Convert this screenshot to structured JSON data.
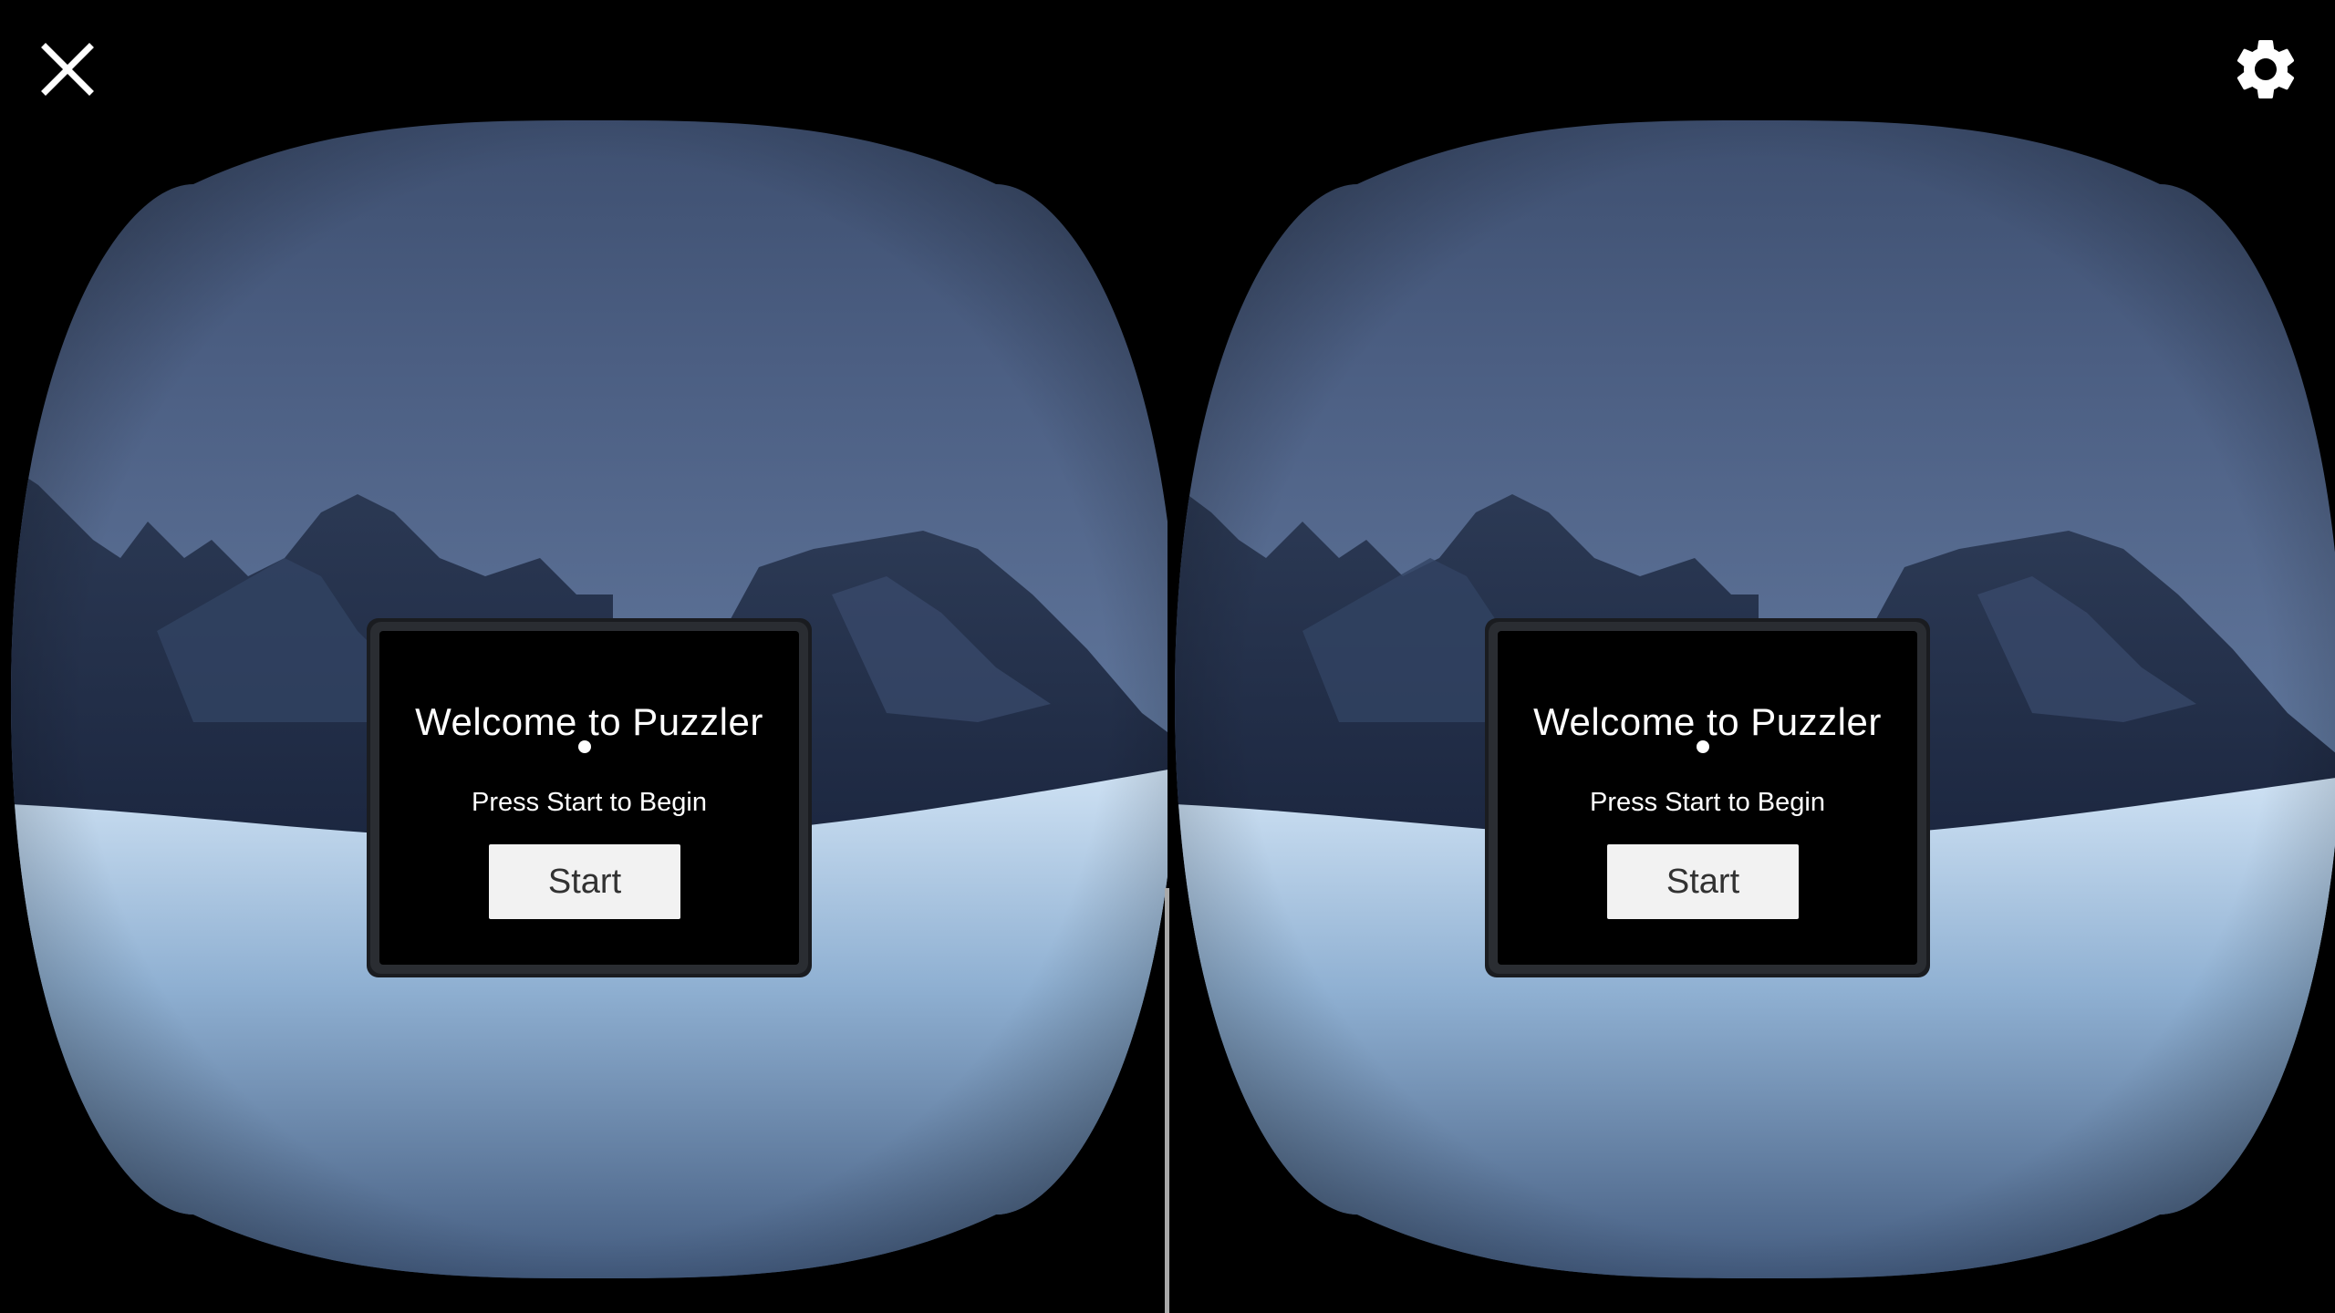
{
  "toolbar": {
    "close_icon": "close-icon",
    "settings_icon": "gear-icon"
  },
  "scene": {
    "sky_color": "#4b5e82",
    "snow_color": "#b9d4ec",
    "mountain_color": "#25324a"
  },
  "left_eye": {
    "title": "Welcome to Puzzler",
    "subtitle": "Press Start to Begin",
    "start_label": "Start"
  },
  "right_eye": {
    "title": "Welcome to Puzzler",
    "subtitle": "Press Start to Begin",
    "start_label": "Start"
  }
}
